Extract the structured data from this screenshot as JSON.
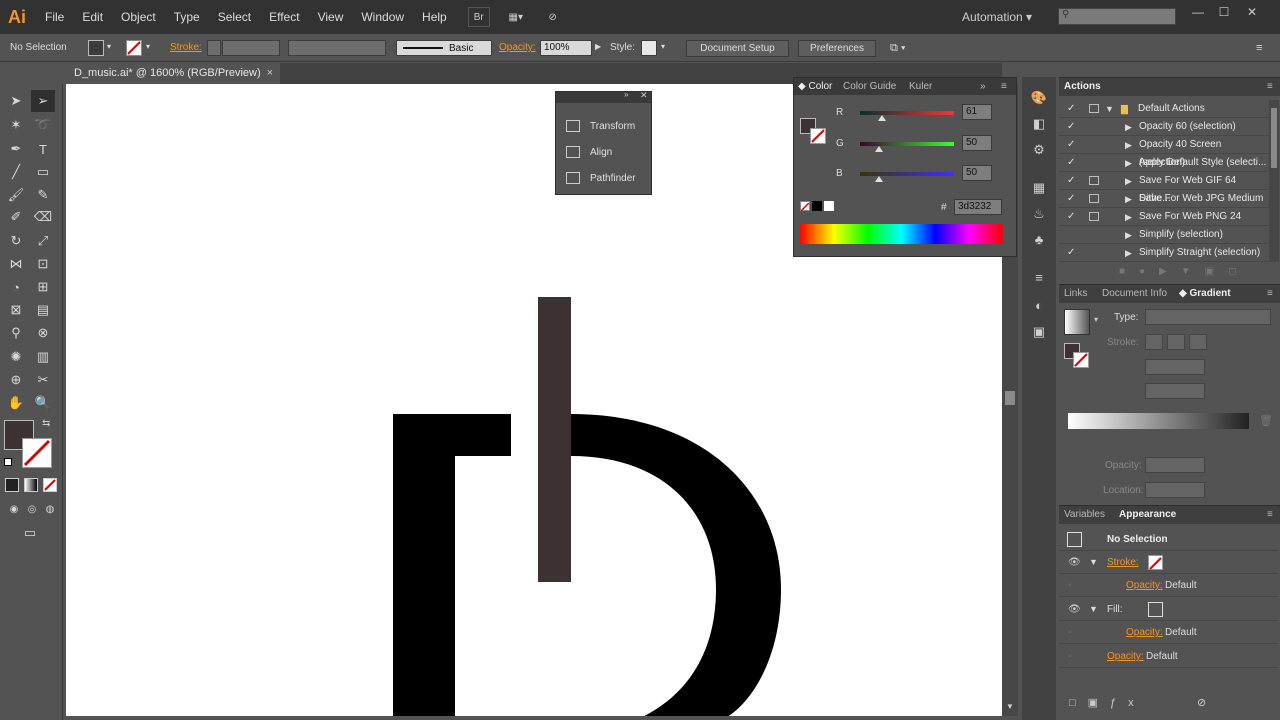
{
  "app": {
    "logo": "Ai",
    "menus": [
      "File",
      "Edit",
      "Object",
      "Type",
      "Select",
      "Effect",
      "View",
      "Window",
      "Help"
    ],
    "bridge_label": "Br",
    "workspace": "Automation"
  },
  "controlbar": {
    "selection": "No Selection",
    "stroke_label": "Stroke:",
    "brush_label": "Basic",
    "opacity_label": "Opacity:",
    "opacity_value": "100%",
    "style_label": "Style:",
    "doc_setup": "Document Setup",
    "preferences": "Preferences"
  },
  "document": {
    "tab_title": "D_music.ai* @ 1600% (RGB/Preview)"
  },
  "floating_panel": {
    "items": [
      "Transform",
      "Align",
      "Pathfinder"
    ]
  },
  "color_panel": {
    "tabs": [
      "Color",
      "Color Guide",
      "Kuler"
    ],
    "r_label": "R",
    "r_value": "61",
    "g_label": "G",
    "g_value": "50",
    "b_label": "B",
    "b_value": "50",
    "hex_label": "#",
    "hex_value": "3d3232"
  },
  "actions_panel": {
    "title": "Actions",
    "set_name": "Default Actions",
    "items": [
      "Opacity 60 (selection)",
      "Opacity 40 Screen (selection)",
      "Apply Default Style (selecti...",
      "Save For Web GIF 64 Dithe...",
      "Save For Web JPG Medium",
      "Save For Web PNG 24",
      "Simplify (selection)",
      "Simplify Straight (selection)"
    ]
  },
  "gradient_panel": {
    "tabs": [
      "Links",
      "Document Info",
      "Gradient"
    ],
    "type_label": "Type:",
    "stroke_label": "Stroke:",
    "opacity_label": "Opacity:",
    "location_label": "Location:"
  },
  "appearance_panel": {
    "tabs": [
      "Variables",
      "Appearance"
    ],
    "no_selection": "No Selection",
    "stroke_label": "Stroke:",
    "fill_label": "Fill:",
    "opacity_label": "Opacity:",
    "default_value": "Default"
  },
  "colors": {
    "ui_dark": "#323232",
    "ui_panel": "#535353",
    "accent_orange": "#f7941d",
    "fill_color": "#3d3232",
    "letter_black": "#000000"
  }
}
